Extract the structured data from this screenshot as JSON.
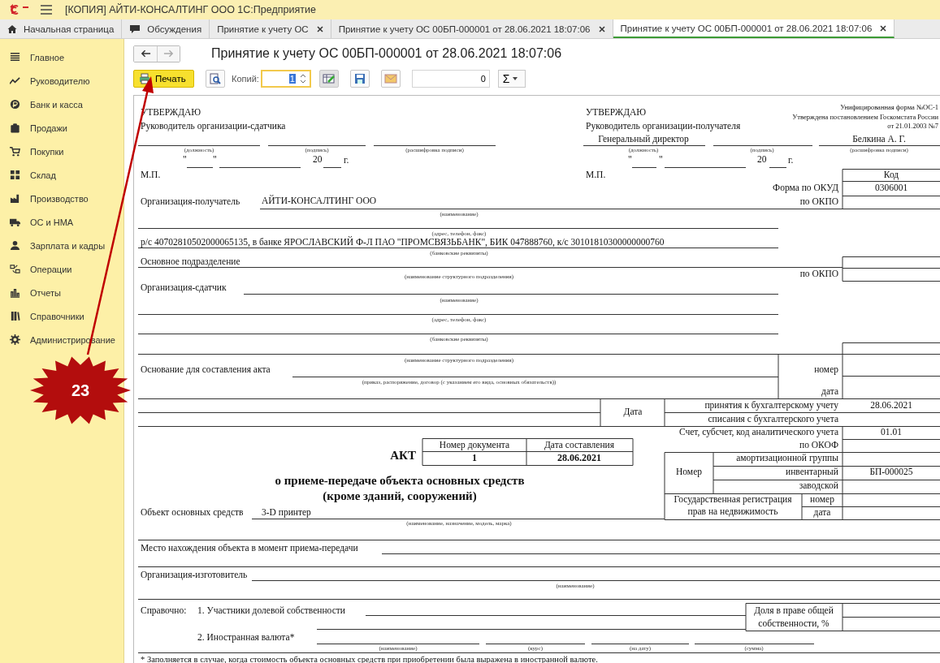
{
  "window": {
    "title": "[КОПИЯ] АЙТИ-КОНСАЛТИНГ ООО 1С:Предприятие"
  },
  "tabs": [
    {
      "label": "Начальная страница",
      "kind": "home",
      "closable": false,
      "selected": false
    },
    {
      "label": "Обсуждения",
      "kind": "chat",
      "closable": false,
      "selected": false
    },
    {
      "label": "Принятие к учету ОС",
      "kind": "plain",
      "closable": true,
      "selected": false
    },
    {
      "label": "Принятие к учету ОС 00БП-000001 от 28.06.2021 18:07:06",
      "kind": "plain",
      "closable": true,
      "selected": false
    },
    {
      "label": "Принятие к учету ОС 00БП-000001 от 28.06.2021 18:07:06",
      "kind": "plain",
      "closable": true,
      "selected": true
    }
  ],
  "sidebar": {
    "items": [
      {
        "label": "Главное"
      },
      {
        "label": "Руководителю"
      },
      {
        "label": "Банк и касса"
      },
      {
        "label": "Продажи"
      },
      {
        "label": "Покупки"
      },
      {
        "label": "Склад"
      },
      {
        "label": "Производство"
      },
      {
        "label": "ОС и НМА"
      },
      {
        "label": "Зарплата и кадры"
      },
      {
        "label": "Операции"
      },
      {
        "label": "Отчеты"
      },
      {
        "label": "Справочники"
      },
      {
        "label": "Администрирование"
      }
    ]
  },
  "form": {
    "title": "Принятие к учету ОС 00БП-000001 от 28.06.2021 18:07:06",
    "forward_disabled": true
  },
  "toolbar": {
    "print_label": "Печать",
    "copies_label": "Копий:",
    "copies_value": "1",
    "copies_focused": true,
    "amount_value": "0",
    "sum_label": "Σ"
  },
  "document": {
    "items": [
      {
        "kind": "label",
        "text": "УТВЕРЖДАЮ"
      },
      {
        "kind": "label",
        "text": "Руководитель организации-сдатчика"
      },
      {
        "kind": "caption",
        "text": "(должность)"
      },
      {
        "kind": "caption",
        "text": "(подпись)"
      },
      {
        "kind": "caption",
        "text": "(расшифровка подписи)"
      },
      {
        "kind": "label",
        "text": "\""
      },
      {
        "kind": "label",
        "text": "\""
      },
      {
        "kind": "label",
        "text": "20"
      },
      {
        "kind": "label",
        "text": "г."
      },
      {
        "kind": "label",
        "text": "М.П."
      },
      {
        "kind": "label",
        "text": "УТВЕРЖДАЮ"
      },
      {
        "kind": "label",
        "text": "Руководитель организации-получателя"
      },
      {
        "kind": "value",
        "text": "Генеральный директор"
      },
      {
        "kind": "value",
        "text": "Белкина А. Г."
      },
      {
        "kind": "caption",
        "text": "(должность)"
      },
      {
        "kind": "caption",
        "text": "(подпись)"
      },
      {
        "kind": "caption",
        "text": "(расшифровка подписи)"
      },
      {
        "kind": "label",
        "text": "\""
      },
      {
        "kind": "label",
        "text": "\""
      },
      {
        "kind": "label",
        "text": "20"
      },
      {
        "kind": "label",
        "text": "г."
      },
      {
        "kind": "label",
        "text": "М.П."
      },
      {
        "kind": "note",
        "text": "Унифицированная форма №ОС-1"
      },
      {
        "kind": "note",
        "text": "Утверждена постановлением Госкомстата России"
      },
      {
        "kind": "note",
        "text": "от 21.01.2003 №7"
      },
      {
        "kind": "label",
        "text": "Код"
      },
      {
        "kind": "label",
        "text": "Форма по ОКУД"
      },
      {
        "kind": "value",
        "text": "0306001"
      },
      {
        "kind": "label",
        "text": "Организация-получатель"
      },
      {
        "kind": "value",
        "text": "АЙТИ-КОНСАЛТИНГ ООО"
      },
      {
        "kind": "label",
        "text": "по ОКПО"
      },
      {
        "kind": "caption",
        "text": "(наименование)"
      },
      {
        "kind": "caption",
        "text": "(адрес, телефон, факс)"
      },
      {
        "kind": "value",
        "text": "р/с 40702810502000065135, в банке ЯРОСЛАВСКИЙ Ф-Л ПАО \"ПРОМСВЯЗЬБАНК\", БИК 047888760, к/с 30101810300000000760"
      },
      {
        "kind": "caption",
        "text": "(банковские реквизиты)"
      },
      {
        "kind": "label",
        "text": "Основное подразделение"
      },
      {
        "kind": "caption",
        "text": "(наименование структурного подразделения)"
      },
      {
        "kind": "label",
        "text": "по ОКПО"
      },
      {
        "kind": "label",
        "text": "Организация-сдатчик"
      },
      {
        "kind": "caption",
        "text": "(наименование)"
      },
      {
        "kind": "caption",
        "text": "(адрес, телефон, факс)"
      },
      {
        "kind": "caption",
        "text": "(банковские реквизиты)"
      },
      {
        "kind": "caption",
        "text": "(наименование структурного подразделения)"
      },
      {
        "kind": "label",
        "text": "Основание для составления акта"
      },
      {
        "kind": "caption",
        "text": "(приказ, распоряжение, договор (с указанием его вида, основных обязательств))"
      },
      {
        "kind": "label",
        "text": "номер"
      },
      {
        "kind": "label",
        "text": "дата"
      },
      {
        "kind": "label",
        "text": "Дата"
      },
      {
        "kind": "label",
        "text": "принятия к бухгалтерскому учету"
      },
      {
        "kind": "value",
        "text": "28.06.2021"
      },
      {
        "kind": "label",
        "text": "списания с бухгалтерского учета"
      },
      {
        "kind": "label",
        "text": "Счет, субсчет, код аналитического учета"
      },
      {
        "kind": "value",
        "text": "01.01"
      },
      {
        "kind": "label",
        "text": "по ОКОФ"
      },
      {
        "kind": "title",
        "text": "АКТ"
      },
      {
        "kind": "label",
        "text": "Номер документа"
      },
      {
        "kind": "label",
        "text": "Дата составления"
      },
      {
        "kind": "cell",
        "text": "1"
      },
      {
        "kind": "cell",
        "text": "28.06.2021"
      },
      {
        "kind": "label",
        "text": "Номер"
      },
      {
        "kind": "label",
        "text": "амортизационной группы"
      },
      {
        "kind": "label",
        "text": "инвентарный"
      },
      {
        "kind": "value",
        "text": "БП-000025"
      },
      {
        "kind": "label",
        "text": "заводской"
      },
      {
        "kind": "label",
        "text": "Государственная регистрация"
      },
      {
        "kind": "label",
        "text": "прав на недвижимость"
      },
      {
        "kind": "label",
        "text": "номер"
      },
      {
        "kind": "label",
        "text": "дата"
      },
      {
        "kind": "title",
        "text": "о приеме-передаче объекта основных средств"
      },
      {
        "kind": "title",
        "text": "(кроме зданий, сооружений)"
      },
      {
        "kind": "label",
        "text": "Объект основных средств"
      },
      {
        "kind": "value",
        "text": "3-D принтер"
      },
      {
        "kind": "caption",
        "text": "(наименование, назначение, модель, марка)"
      },
      {
        "kind": "label",
        "text": "Место нахождения объекта в момент приема-передачи"
      },
      {
        "kind": "label",
        "text": "Организация-изготовитель"
      },
      {
        "kind": "caption",
        "text": "(наименование)"
      },
      {
        "kind": "label",
        "text": "Справочно:"
      },
      {
        "kind": "label",
        "text": "1. Участники долевой собственности"
      },
      {
        "kind": "label",
        "text": "Доля в праве общей"
      },
      {
        "kind": "label",
        "text": "собственности, %"
      },
      {
        "kind": "label",
        "text": "2. Иностранная валюта*"
      },
      {
        "kind": "caption",
        "text": "(наименование)"
      },
      {
        "kind": "caption",
        "text": "(курс)"
      },
      {
        "kind": "caption",
        "text": "(на дату)"
      },
      {
        "kind": "caption",
        "text": "(сумма)"
      },
      {
        "kind": "footnote",
        "text": "* Заполняется в случае, когда стоимость объекта основных средств при приобретении была выражена в иностранной валюте."
      }
    ]
  },
  "annotation": {
    "number": "23"
  }
}
